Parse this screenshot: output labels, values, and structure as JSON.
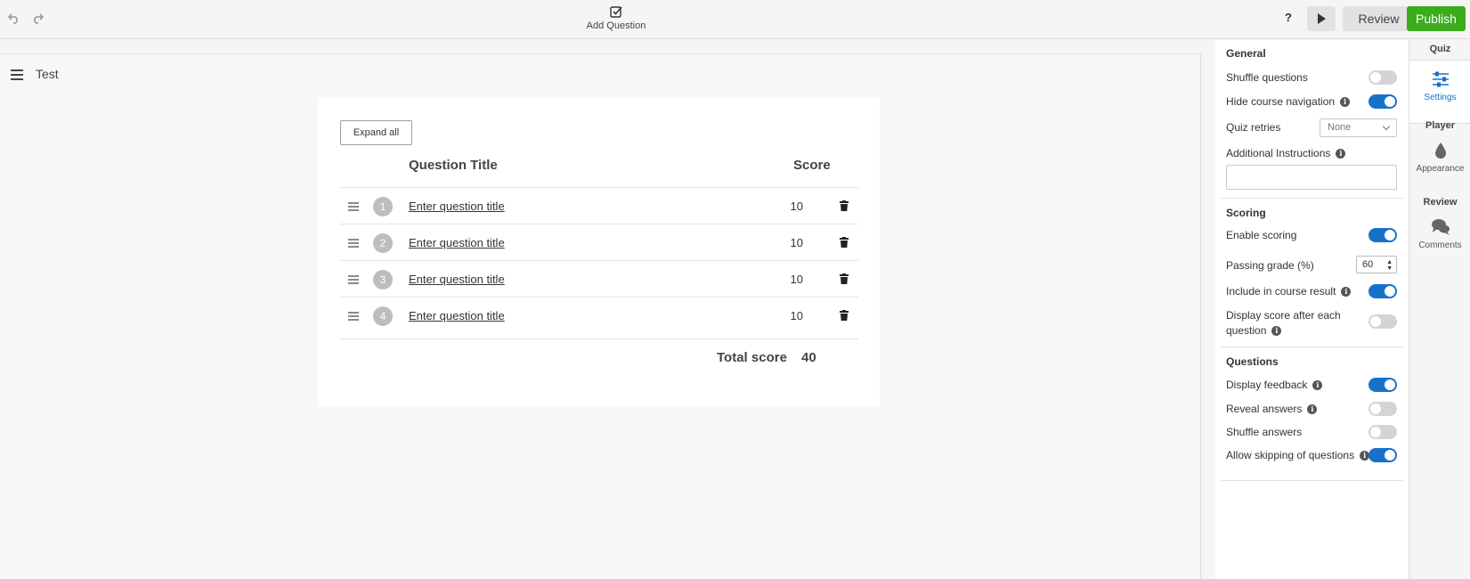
{
  "toolbar": {
    "add_question_label": "Add Question",
    "help_label": "?",
    "review_label": "Review",
    "publish_label": "Publish"
  },
  "canvas": {
    "title": "Test",
    "expand_all_label": "Expand all",
    "columns": {
      "title": "Question Title",
      "score": "Score"
    },
    "questions": [
      {
        "number": "1",
        "title": "Enter question title",
        "score": "10"
      },
      {
        "number": "2",
        "title": "Enter question title",
        "score": "10"
      },
      {
        "number": "3",
        "title": "Enter question title",
        "score": "10"
      },
      {
        "number": "4",
        "title": "Enter question title",
        "score": "10"
      }
    ],
    "total_label": "Total score",
    "total_value": "40"
  },
  "settings": {
    "general": {
      "heading": "General",
      "shuffle_questions": {
        "label": "Shuffle questions",
        "on": false
      },
      "hide_course_navigation": {
        "label": "Hide course navigation",
        "on": true
      },
      "quiz_retries": {
        "label": "Quiz retries",
        "value": "None"
      },
      "additional_instructions": {
        "label": "Additional Instructions",
        "value": ""
      }
    },
    "scoring": {
      "heading": "Scoring",
      "enable_scoring": {
        "label": "Enable scoring",
        "on": true
      },
      "passing_grade": {
        "label": "Passing grade (%)",
        "value": "60"
      },
      "include_in_course_result": {
        "label": "Include in course result",
        "on": true
      },
      "display_score": {
        "label_line1": "Display score after each",
        "label_line2": "question",
        "on": false
      }
    },
    "questions": {
      "heading": "Questions",
      "display_feedback": {
        "label": "Display feedback",
        "on": true
      },
      "reveal_answers": {
        "label": "Reveal answers",
        "on": false
      },
      "shuffle_answers": {
        "label": "Shuffle answers",
        "on": false
      },
      "allow_skipping": {
        "label": "Allow skipping of questions",
        "on": true
      }
    }
  },
  "side_tabs": {
    "quiz_heading": "Quiz",
    "settings_label": "Settings",
    "player_heading": "Player",
    "appearance_label": "Appearance",
    "review_heading": "Review",
    "comments_label": "Comments"
  },
  "colors": {
    "accent": "#1672c9",
    "publish": "#3cab1e"
  },
  "icons": {
    "undo": "undo-icon",
    "redo": "redo-icon",
    "add_question": "checkbox-icon",
    "play": "play-icon",
    "menu": "hamburger-icon",
    "drag": "drag-handle-icon",
    "delete": "trash-icon",
    "info": "info-icon",
    "settings": "sliders-icon",
    "appearance": "droplet-icon",
    "comments": "chat-bubbles-icon"
  }
}
